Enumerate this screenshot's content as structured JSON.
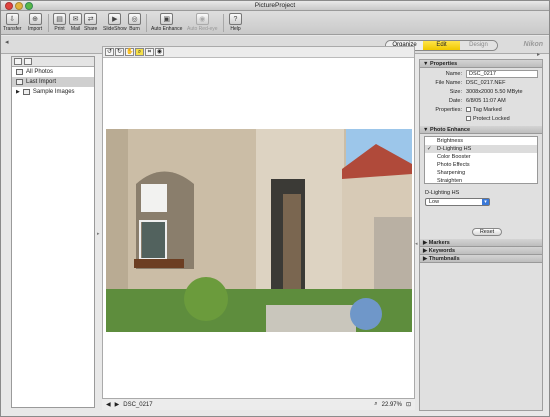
{
  "app": {
    "title": "PictureProject",
    "brand": "Nikon"
  },
  "toolbar": [
    {
      "label": "Transfer",
      "icon": "transfer-icon",
      "glyph": "⇩"
    },
    {
      "label": "Import",
      "icon": "import-icon",
      "glyph": "⊕"
    },
    {
      "label": "Print",
      "icon": "print-icon",
      "glyph": "▤"
    },
    {
      "label": "Mail",
      "icon": "mail-icon",
      "glyph": "✉"
    },
    {
      "label": "Share",
      "icon": "share-icon",
      "glyph": "⇄"
    },
    {
      "label": "SlideShow",
      "icon": "slideshow-icon",
      "glyph": "▶"
    },
    {
      "label": "Burn",
      "icon": "burn-icon",
      "glyph": "◎"
    },
    {
      "label": "Auto Enhance",
      "icon": "auto-enhance-icon",
      "glyph": "▣"
    },
    {
      "label": "Auto Red-eye",
      "icon": "red-eye-icon",
      "glyph": "◉"
    },
    {
      "label": "Help",
      "icon": "help-icon",
      "glyph": "?"
    }
  ],
  "modes": {
    "organize": "Organize",
    "edit": "Edit",
    "design": "Design"
  },
  "sidebar": {
    "items": [
      {
        "label": "All Photos"
      },
      {
        "label": "Last Import"
      },
      {
        "label": "Sample Images"
      }
    ]
  },
  "status": {
    "filename": "DSC_0217",
    "zoom": "22.97%"
  },
  "properties": {
    "header": "Properties",
    "name_label": "Name:",
    "name": "DSC_0217",
    "file_label": "File Name:",
    "file": "DSC_0217.NEF",
    "size_label": "Size:",
    "size": "3008x2000  5.50 MByte",
    "date_label": "Date:",
    "date": "6/8/05 11:07 AM",
    "props_label": "Properties:",
    "tag": "Tag Marked",
    "protect": "Protect Locked"
  },
  "enhance": {
    "header": "Photo Enhance",
    "items": [
      "Brightness",
      "D-Lighting HS",
      "Color Booster",
      "Photo Effects",
      "Sharpening",
      "Straighten"
    ],
    "sub_label": "D-Lighting HS",
    "select_value": "Low",
    "reset": "Reset"
  },
  "panels": {
    "markers": "Markers",
    "keywords": "Keywords",
    "thumbnails": "Thumbnails"
  },
  "colors": {
    "accent": "#f5d000",
    "select_blue": "#3b79d8"
  }
}
